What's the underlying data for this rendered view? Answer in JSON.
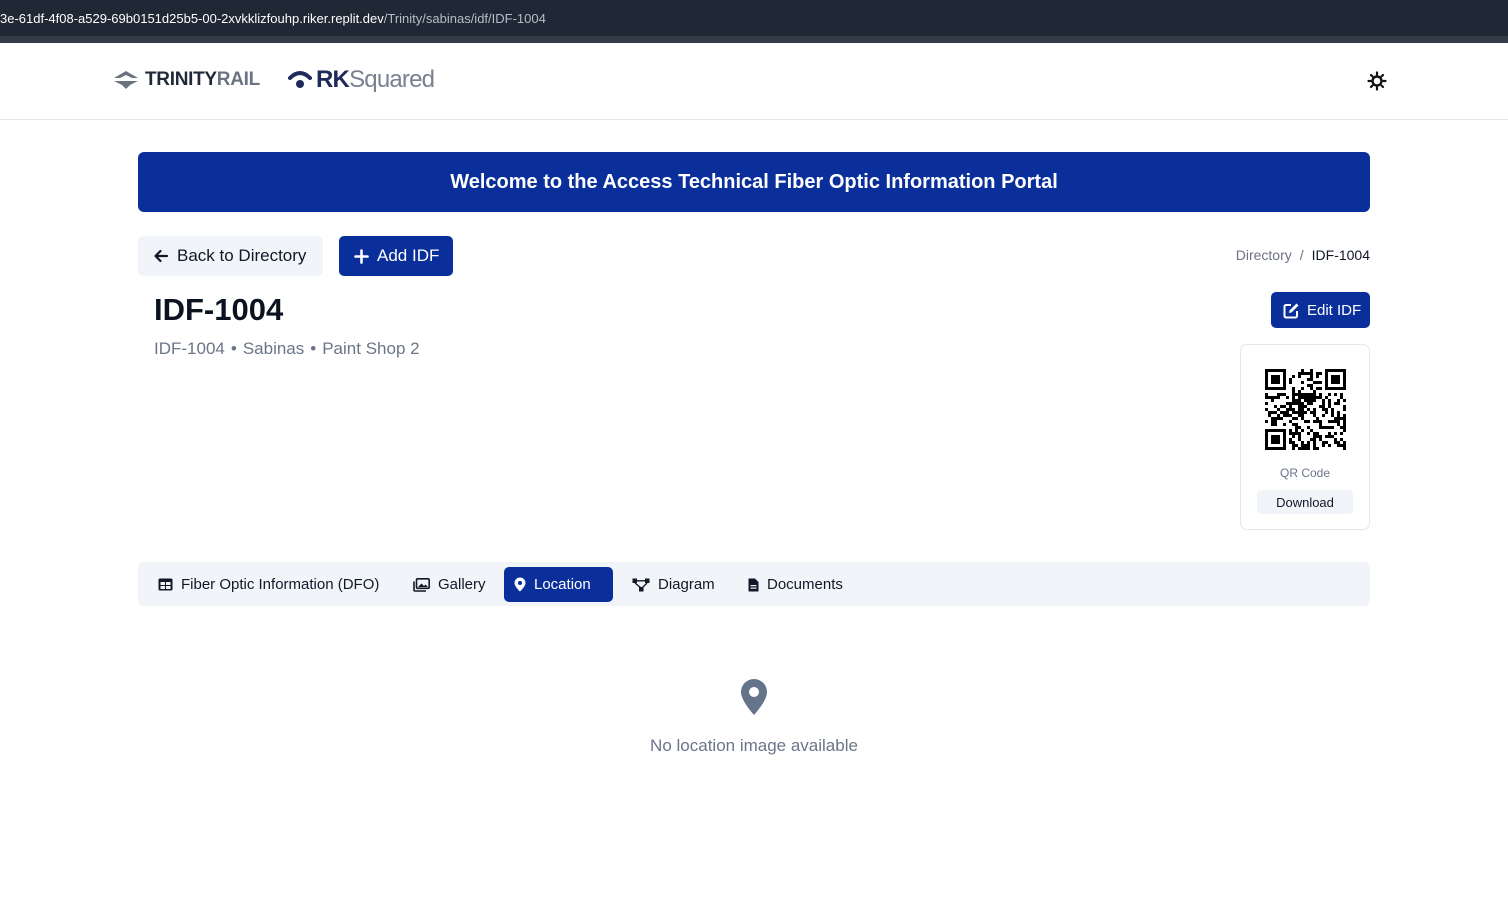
{
  "browser": {
    "url_host": "3e-61df-4f08-a529-69b0151d25b5-00-2xvkklizfouhp.riker.replit.dev",
    "url_path": "/Trinity/sabinas/idf/IDF-1004"
  },
  "header": {
    "logo_trinity_bold": "TRINITY",
    "logo_trinity_light": "RAIL",
    "logo_rk_bold": "RK",
    "logo_rk_light": "Squared",
    "theme_toggle_icon": "sun-icon"
  },
  "banner": {
    "text": "Welcome to the Access Technical Fiber Optic Information Portal"
  },
  "actions": {
    "back_label": "Back to Directory",
    "add_label": "Add IDF",
    "edit_label": "Edit IDF"
  },
  "breadcrumb": {
    "parent": "Directory",
    "separator": "/",
    "current": "IDF-1004"
  },
  "idf": {
    "title": "IDF-1004",
    "subtitle_parts": [
      "IDF-1004",
      "•",
      "Sabinas",
      "•",
      "Paint Shop 2"
    ]
  },
  "qr": {
    "label": "QR Code",
    "download_label": "Download"
  },
  "tabs": [
    {
      "label": "Fiber Optic Information (DFO)",
      "icon": "table-icon",
      "active": false
    },
    {
      "label": "Gallery",
      "icon": "images-icon",
      "active": false
    },
    {
      "label": "Location",
      "icon": "map-pin-icon",
      "active": true
    },
    {
      "label": "Diagram",
      "icon": "network-icon",
      "active": false
    },
    {
      "label": "Documents",
      "icon": "file-icon",
      "active": false
    }
  ],
  "location": {
    "empty_message": "No location image available",
    "empty_icon": "map-pin-icon"
  },
  "colors": {
    "brand_blue": "#0a2f9b",
    "muted_text": "#6b7588",
    "tab_bg": "#f1f5f9"
  }
}
